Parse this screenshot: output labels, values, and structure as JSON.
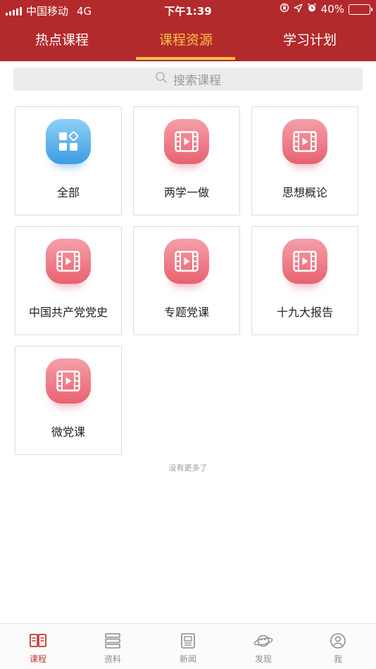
{
  "status_bar": {
    "carrier": "中国移动",
    "network": "4G",
    "time": "下午1:39",
    "battery": "40%",
    "battery_level": 0.4
  },
  "top_tabs": [
    {
      "label": "热点课程",
      "active": false
    },
    {
      "label": "课程资源",
      "active": true
    },
    {
      "label": "学习计划",
      "active": false
    }
  ],
  "search": {
    "placeholder": "搜索课程"
  },
  "categories": [
    {
      "label": "全部",
      "icon": "all-categories-icon",
      "color": "blue"
    },
    {
      "label": "两学一做",
      "icon": "film-play-icon",
      "color": "red"
    },
    {
      "label": "思想概论",
      "icon": "film-play-icon",
      "color": "red"
    },
    {
      "label": "中国共产党党史",
      "icon": "film-play-icon",
      "color": "red"
    },
    {
      "label": "专题党课",
      "icon": "film-play-icon",
      "color": "red"
    },
    {
      "label": "十九大报告",
      "icon": "film-play-icon",
      "color": "red"
    },
    {
      "label": "微党课",
      "icon": "film-play-icon",
      "color": "red"
    }
  ],
  "end_note": "没有更多了",
  "bottom_tabs": [
    {
      "label": "课程",
      "icon": "book-icon",
      "active": true
    },
    {
      "label": "资料",
      "icon": "stack-icon",
      "active": false
    },
    {
      "label": "新闻",
      "icon": "newspaper-icon",
      "active": false
    },
    {
      "label": "发现",
      "icon": "planet-icon",
      "active": false
    },
    {
      "label": "我",
      "icon": "user-icon",
      "active": false
    }
  ],
  "colors": {
    "header_bg": "#b32a2c",
    "active_tab": "#f7c244",
    "bottom_active": "#c0392b"
  }
}
